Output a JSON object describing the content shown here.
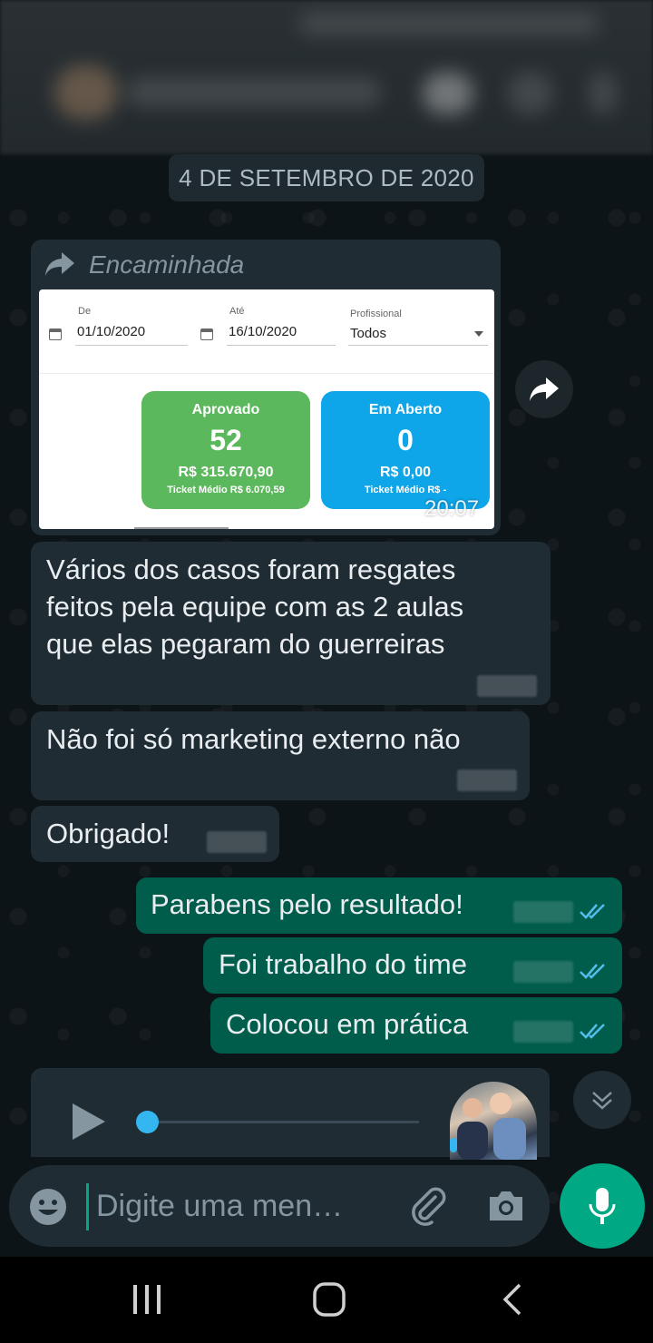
{
  "chat": {
    "date_chip": "4 DE SETEMBRO DE 2020"
  },
  "forwarded": {
    "label": "Encaminhada",
    "time": "20:07",
    "screenshot": {
      "from_label": "De",
      "from_value": "01/10/2020",
      "to_label": "Até",
      "to_value": "16/10/2020",
      "professional_label": "Profissional",
      "professional_value": "Todos",
      "approved": {
        "title": "Aprovado",
        "count": "52",
        "amount": "R$ 315.670,90",
        "ticket": "Ticket Médio R$ 6.070,59",
        "color": "#5cb85c"
      },
      "open": {
        "title": "Em Aberto",
        "count": "0",
        "amount": "R$ 0,00",
        "ticket": "Ticket Médio R$ -",
        "color": "#0ea5e9"
      }
    }
  },
  "messages": {
    "in1_line1": "Vários dos casos foram resgates",
    "in1_line2": "feitos pela equipe com as 2 aulas",
    "in1_line3": "que elas pegaram do guerreiras",
    "in2": "Não foi só marketing externo não",
    "in3": "Obrigado!",
    "out1": "Parabens pelo resultado!",
    "out2": "Foi trabalho do time",
    "out3": "Colocou em prática"
  },
  "voice_note": {
    "progress": 0.0
  },
  "composer": {
    "placeholder": "Digite uma men…"
  },
  "icons": {
    "forward": "share-arrow-icon",
    "emoji": "emoji-icon",
    "attach": "paperclip-icon",
    "camera": "camera-icon",
    "mic": "microphone-icon",
    "scroll_down": "double-chevron-down-icon"
  },
  "colors": {
    "outgoing_bubble": "#005c4b",
    "incoming_bubble": "#1f2c33",
    "accent": "#00a884",
    "read_ticks": "#53bdeb"
  }
}
